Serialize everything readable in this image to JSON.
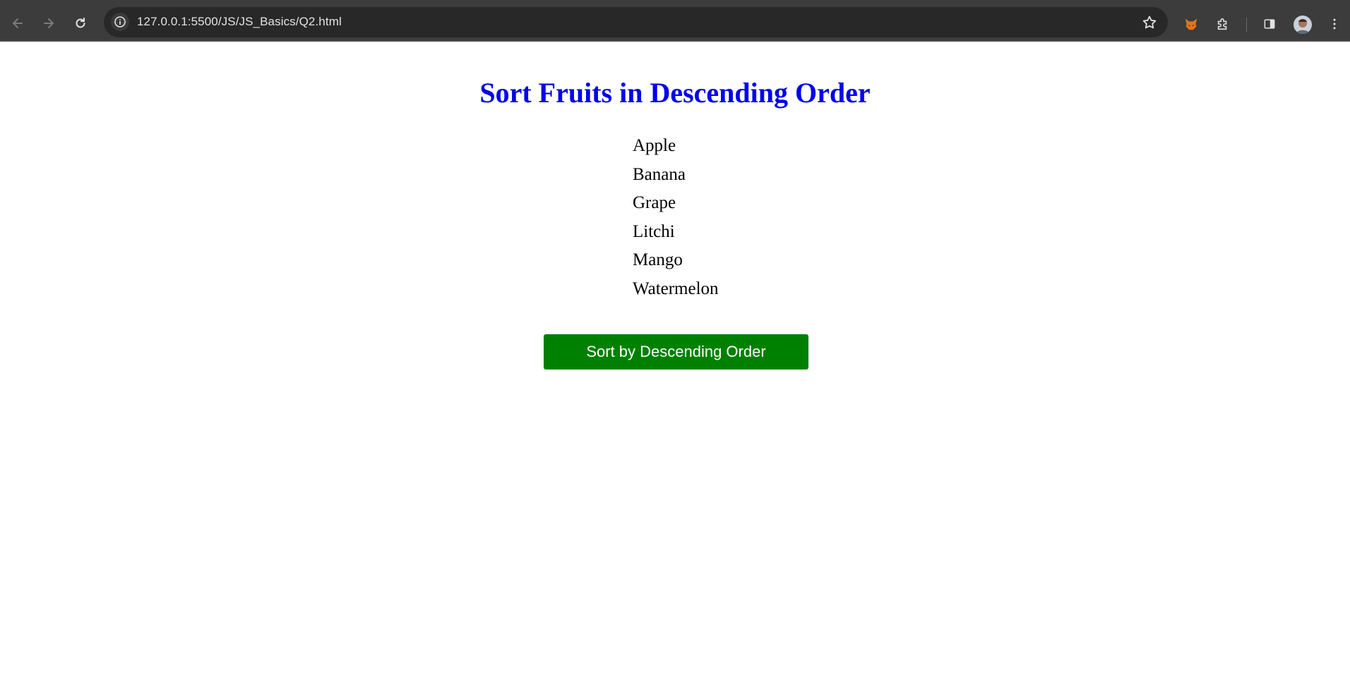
{
  "browser": {
    "url": "127.0.0.1:5500/JS/JS_Basics/Q2.html"
  },
  "page": {
    "title": "Sort Fruits in Descending Order",
    "fruits": [
      "Apple",
      "Banana",
      "Grape",
      "Litchi",
      "Mango",
      "Watermelon"
    ],
    "button_label": "Sort by Descending Order"
  },
  "icons": {
    "back": "arrow-left-icon",
    "forward": "arrow-right-icon",
    "reload": "reload-icon",
    "site_info": "info-icon",
    "bookmark": "star-icon",
    "extension_fox": "fox-extension-icon",
    "extensions": "puzzle-icon",
    "side_panel": "side-panel-icon",
    "profile": "avatar",
    "menu": "kebab-menu-icon"
  },
  "colors": {
    "title": "#0000ee",
    "button_bg": "#008000",
    "button_text": "#ffffff",
    "toolbar_bg": "#3c3c3c",
    "omnibox_bg": "#282828"
  }
}
